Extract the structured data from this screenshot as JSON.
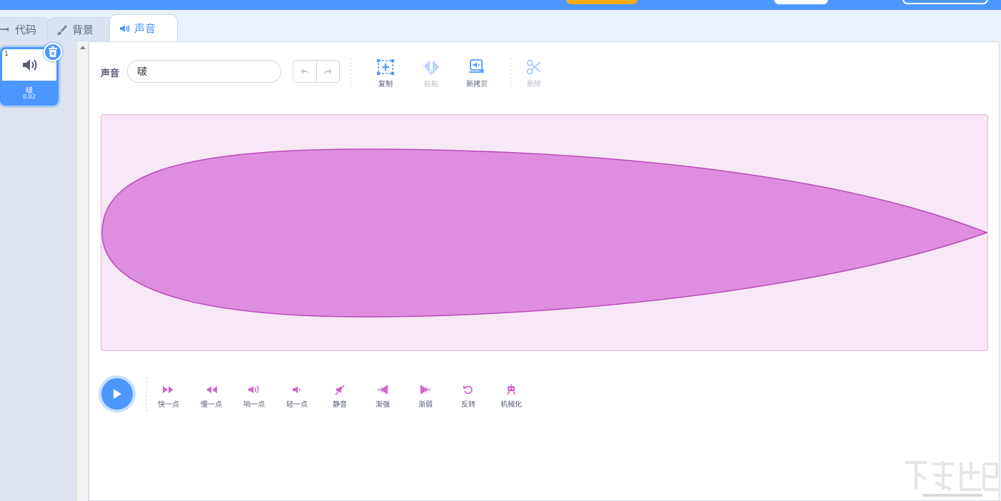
{
  "colors": {
    "accent": "#4c97ff",
    "wave_fill": "#dd8ede",
    "wave_stroke": "#b84cb9",
    "wave_bg": "#f8e7f6",
    "effect_icon": "#cf63cf"
  },
  "tabs": [
    {
      "label": "代码",
      "icon": "code-icon"
    },
    {
      "label": "背景",
      "icon": "brush-icon"
    },
    {
      "label": "声音",
      "icon": "speaker-icon"
    }
  ],
  "sound_list": {
    "items": [
      {
        "index": "1",
        "name": "啵",
        "duration": "0.02"
      }
    ]
  },
  "editor": {
    "name_label": "声音",
    "name_value": "啵",
    "tools": [
      {
        "label": "复制",
        "icon": "copy-icon"
      },
      {
        "label": "粘贴",
        "icon": "paste-icon"
      },
      {
        "label": "新拷贝",
        "icon": "new-copy-icon"
      },
      {
        "label": "删除",
        "icon": "scissors-icon"
      }
    ],
    "effects": [
      {
        "label": "快一点",
        "icon": "faster-icon"
      },
      {
        "label": "慢一点",
        "icon": "slower-icon"
      },
      {
        "label": "响一点",
        "icon": "louder-icon"
      },
      {
        "label": "轻一点",
        "icon": "softer-icon"
      },
      {
        "label": "静音",
        "icon": "mute-icon"
      },
      {
        "label": "渐强",
        "icon": "fade-in-icon"
      },
      {
        "label": "渐弱",
        "icon": "fade-out-icon"
      },
      {
        "label": "反转",
        "icon": "reverse-icon"
      },
      {
        "label": "机械化",
        "icon": "robot-icon"
      }
    ]
  },
  "watermark": {
    "icon": "site-logo-watermark"
  }
}
